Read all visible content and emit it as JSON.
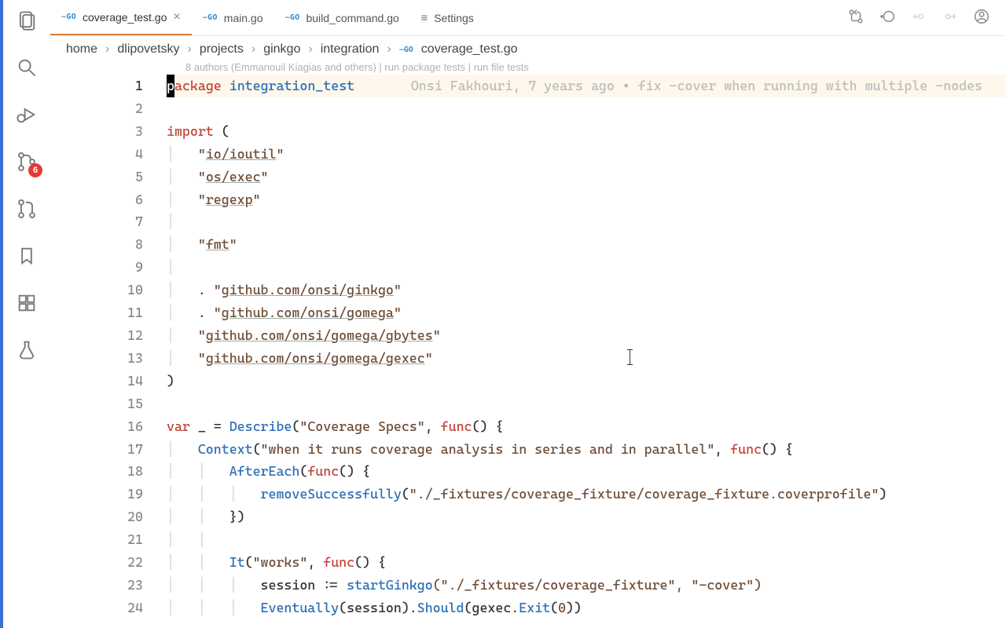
{
  "tabs": [
    {
      "icon": "go",
      "label": "coverage_test.go",
      "active": true,
      "closable": true
    },
    {
      "icon": "go",
      "label": "main.go"
    },
    {
      "icon": "go",
      "label": "build_command.go"
    },
    {
      "icon": "settings",
      "label": "Settings"
    }
  ],
  "scm_badge": "6",
  "breadcrumbs": {
    "segments": [
      "home",
      "dlipovetsky",
      "projects",
      "ginkgo",
      "integration"
    ],
    "file_icon": "go",
    "file": "coverage_test.go"
  },
  "codelens": "8 authors (Emmanouil Kiagias and others) | run package tests | run file tests",
  "blame": "Onsi Fakhouri, 7 years ago • fix -cover when running with multiple -nodes",
  "code": {
    "package_kw": "ackage",
    "package_name": "integration_test",
    "import_kw": "import",
    "open_paren": " (",
    "imports": {
      "ioutil": "io/ioutil",
      "osexec": "os/exec",
      "regexp": "regexp",
      "fmt": "fmt",
      "ginkgo": "github.com/onsi/ginkgo",
      "gomega": "github.com/onsi/gomega",
      "gbytes": "github.com/onsi/gomega/gbytes",
      "gexec": "github.com/onsi/gomega/gexec"
    },
    "close_paren": ")",
    "var_kw": "var",
    "underscore": " _ = ",
    "describe": "Describe",
    "describe_str": "\"Coverage Specs\"",
    "func_kw": "func",
    "context": "Context",
    "context_str": "\"when it runs coverage analysis in series and in parallel\"",
    "after_each": "AfterEach",
    "remove_call": "removeSuccessfully",
    "remove_arg": "\"./_fixtures/coverage_fixture/coverage_fixture.coverprofile\"",
    "it": "It",
    "it_str": "\"works\"",
    "session_line_a": "session := ",
    "start_ginkgo": "startGinkgo",
    "start_args": "(\"./_fixtures/coverage_fixture\", \"-cover\")",
    "eventually": "Eventually",
    "should": "Should",
    "exit": "Exit",
    "gexec_ref": "gexec",
    "zero": "0"
  },
  "line_numbers": [
    "1",
    "2",
    "3",
    "4",
    "5",
    "6",
    "7",
    "8",
    "9",
    "10",
    "11",
    "12",
    "13",
    "14",
    "15",
    "16",
    "17",
    "18",
    "19",
    "20",
    "21",
    "22",
    "23",
    "24"
  ]
}
